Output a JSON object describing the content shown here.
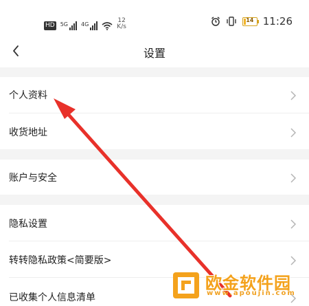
{
  "status_bar": {
    "hd_badge": "HD",
    "network_1": "5G",
    "network_2": "4G",
    "speed_value": "12",
    "speed_unit": "K/s",
    "battery_level": "14",
    "time": "11:26",
    "icons": [
      "hd-icon",
      "signal-icon",
      "signal-icon",
      "wifi-icon",
      "alarm-icon",
      "vibrate-icon",
      "battery-icon"
    ]
  },
  "header": {
    "title": "设置",
    "back_icon": "chevron-left-icon"
  },
  "settings": {
    "groups": [
      {
        "items": [
          {
            "label": "个人资料"
          },
          {
            "label": "收货地址"
          }
        ]
      },
      {
        "items": [
          {
            "label": "账户与安全"
          }
        ]
      },
      {
        "items": [
          {
            "label": "隐私设置"
          },
          {
            "label": "转转隐私政策<简要版>"
          },
          {
            "label": "已收集个人信息清单"
          }
        ]
      }
    ]
  },
  "annotation": {
    "type": "arrow",
    "color": "#e8312a"
  },
  "watermark": {
    "title": "欧金软件园",
    "url": "www.apoujin.com",
    "color": "#f4a21c"
  },
  "colors": {
    "background": "#ffffff",
    "group_gap": "#f4f4f4",
    "chevron": "#b5b5b5"
  }
}
